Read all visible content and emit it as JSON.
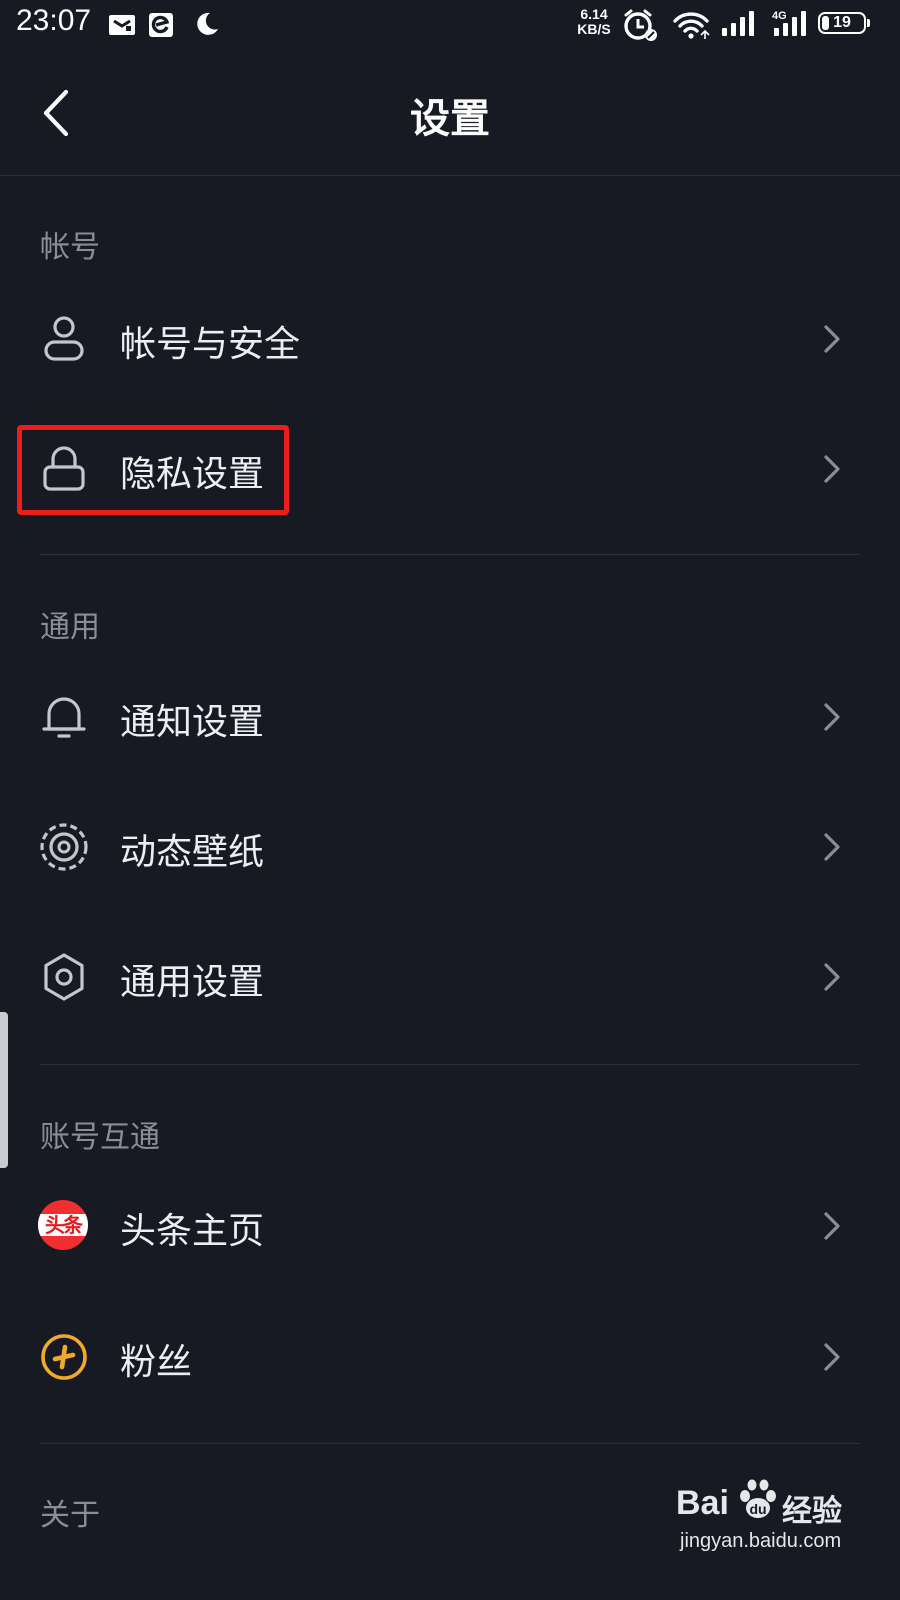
{
  "status_bar": {
    "time": "23:07",
    "net_speed_value": "6.14",
    "net_speed_unit": "KB/S",
    "network_type": "4G",
    "battery_level": "19",
    "icons": [
      "notification-icon",
      "browser-icon",
      "moon-icon",
      "alarm-icon",
      "wifi-icon",
      "signal-icon",
      "signal-4g-icon",
      "battery-icon"
    ]
  },
  "header": {
    "title": "设置",
    "back_icon": "back-arrow-icon"
  },
  "sections": {
    "account": {
      "title": "帐号",
      "items": [
        {
          "label": "帐号与安全",
          "icon": "user-icon"
        },
        {
          "label": "隐私设置",
          "icon": "lock-icon",
          "highlighted": true
        }
      ]
    },
    "general": {
      "title": "通用",
      "items": [
        {
          "label": "通知设置",
          "icon": "bell-icon"
        },
        {
          "label": "动态壁纸",
          "icon": "live-wallpaper-icon"
        },
        {
          "label": "通用设置",
          "icon": "gear-icon"
        }
      ]
    },
    "linked": {
      "title": "账号互通",
      "items": [
        {
          "label": "头条主页",
          "icon": "toutiao-icon",
          "icon_text": "头条"
        },
        {
          "label": "粉丝",
          "icon": "fans-app-icon"
        }
      ]
    },
    "about": {
      "title": "关于"
    }
  },
  "watermark": {
    "brand": "Bai",
    "brand_suffix": "经验",
    "url": "jingyan.baidu.com"
  },
  "colors": {
    "background": "#171923",
    "text_primary": "#eceef2",
    "text_secondary": "#8a8d97",
    "divider": "#2c2f3a",
    "highlight": "#f01c1c",
    "toutiao_red": "#f03030",
    "fans_yellow": "#f0a92a"
  }
}
